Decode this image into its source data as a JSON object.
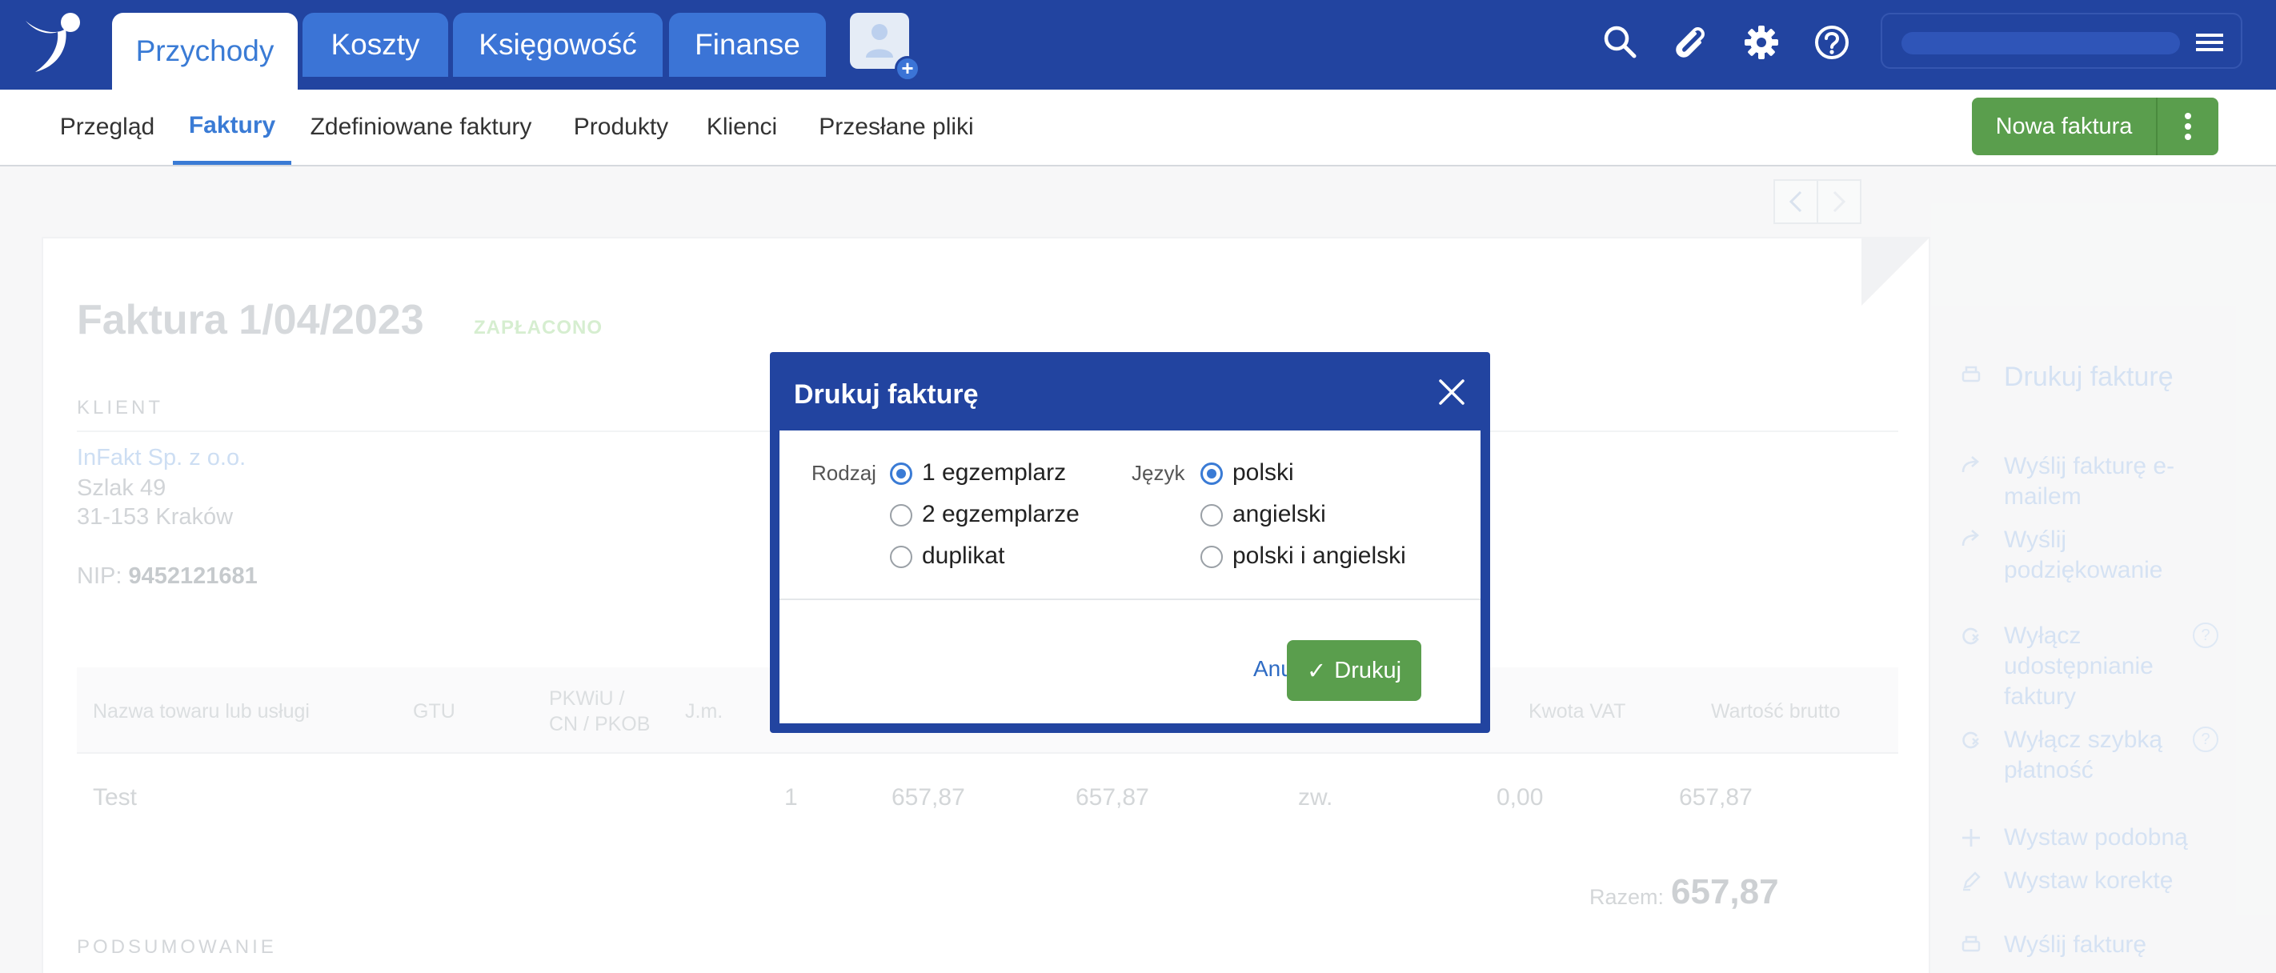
{
  "topbar": {
    "tabs": [
      {
        "label": "Przychody",
        "active": true
      },
      {
        "label": "Koszty",
        "active": false
      },
      {
        "label": "Księgowość",
        "active": false
      },
      {
        "label": "Finanse",
        "active": false
      }
    ],
    "add_user_plus": "+",
    "icons": [
      "search-icon",
      "paperclip-icon",
      "gear-icon",
      "help-icon"
    ],
    "menu_icon": "hamburger-icon"
  },
  "subnav": {
    "items": [
      {
        "label": "Przegląd",
        "active": false
      },
      {
        "label": "Faktury",
        "active": true
      },
      {
        "label": "Zdefiniowane faktury",
        "active": false
      },
      {
        "label": "Produkty",
        "active": false
      },
      {
        "label": "Klienci",
        "active": false
      },
      {
        "label": "Przesłane pliki",
        "active": false
      }
    ],
    "new_invoice_label": "Nowa faktura"
  },
  "invoice": {
    "title": "Faktura 1/04/2023",
    "status": "ZAPŁACONO",
    "client_section": "KLIENT",
    "client": {
      "name": "InFakt Sp. z o.o.",
      "street": "Szlak 49",
      "city": "31-153 Kraków",
      "nip_label": "NIP:",
      "nip": "9452121681"
    },
    "table": {
      "headers": {
        "name": "Nazwa towaru lub usługi",
        "gtu": "GTU",
        "pkwiu": "PKWiU /",
        "pkwiu2": "CN / PKOB",
        "unit": "J.m.",
        "vat_amount": "Kwota VAT",
        "gross": "Wartość brutto"
      },
      "row": {
        "name": "Test",
        "qty": "1",
        "unit_price": "657,87",
        "net": "657,87",
        "vat_rate": "zw.",
        "vat_amount": "0,00",
        "gross": "657,87"
      }
    },
    "total_label": "Razem:",
    "total_value": "657,87",
    "summary_section": "PODSUMOWANIE"
  },
  "actions": {
    "print": "Drukuj fakturę",
    "send_email_1": "Wyślij fakturę e-",
    "send_email_2": "mailem",
    "thanks_1": "Wyślij",
    "thanks_2": "podziękowanie",
    "disable_share_1": "Wyłącz",
    "disable_share_2": "udostępnianie",
    "disable_share_3": "faktury",
    "disable_fast_1": "Wyłącz szybką",
    "disable_fast_2": "płatność",
    "similar": "Wystaw podobną",
    "correction": "Wystaw korektę",
    "send_invoice": "Wyślij fakturę",
    "help_glyph": "?"
  },
  "modal": {
    "title": "Drukuj fakturę",
    "type_label": "Rodzaj",
    "type_options": [
      {
        "label": "1 egzemplarz",
        "checked": true
      },
      {
        "label": "2 egzemplarze",
        "checked": false
      },
      {
        "label": "duplikat",
        "checked": false
      }
    ],
    "language_label": "Język",
    "language_options": [
      {
        "label": "polski",
        "checked": true
      },
      {
        "label": "angielski",
        "checked": false
      },
      {
        "label": "polski i angielski",
        "checked": false
      }
    ],
    "cancel_label": "Anuluj",
    "print_label": "Drukuj",
    "print_check": "✓"
  },
  "colors": {
    "brand_blue": "#2244a0",
    "tab_blue": "#3b74d6",
    "accent": "#3a7bd5",
    "green": "#5a9e4d"
  }
}
